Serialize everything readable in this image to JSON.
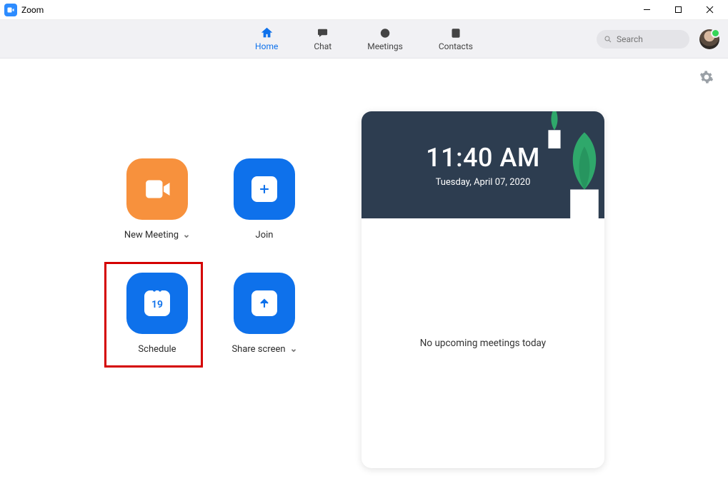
{
  "window": {
    "title": "Zoom"
  },
  "nav": {
    "tabs": [
      {
        "label": "Home",
        "active": true
      },
      {
        "label": "Chat",
        "active": false
      },
      {
        "label": "Meetings",
        "active": false
      },
      {
        "label": "Contacts",
        "active": false
      }
    ],
    "search_placeholder": "Search"
  },
  "actions": {
    "new_meeting": {
      "label": "New Meeting",
      "has_dropdown": true
    },
    "join": {
      "label": "Join"
    },
    "schedule": {
      "label": "Schedule",
      "calendar_day": "19",
      "highlighted": true
    },
    "share": {
      "label": "Share screen",
      "has_dropdown": true
    }
  },
  "card": {
    "time": "11:40 AM",
    "date": "Tuesday, April 07, 2020",
    "empty_message": "No upcoming meetings today"
  },
  "colors": {
    "accent_blue": "#0E71EB",
    "accent_orange": "#F7913D",
    "hero_bg": "#2D3D50"
  }
}
